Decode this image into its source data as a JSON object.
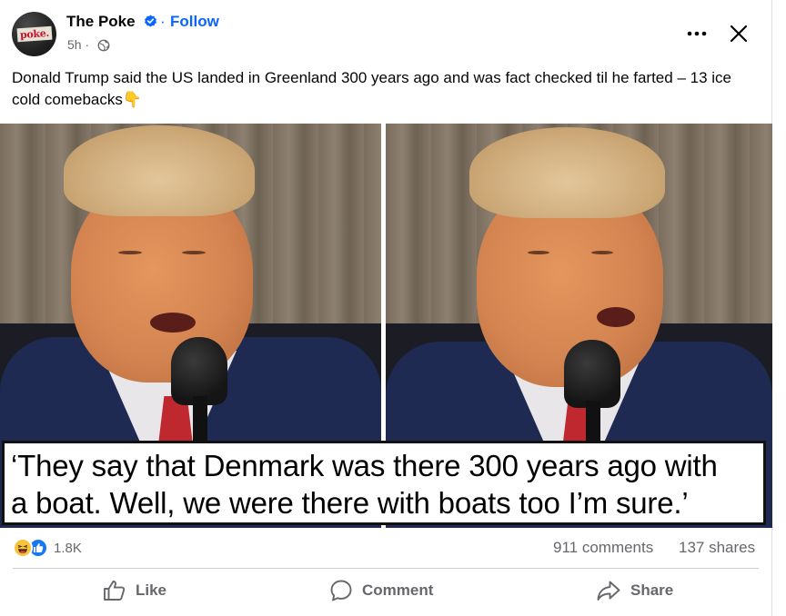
{
  "post": {
    "page_name": "The Poke",
    "avatar_text": "poke.",
    "follow_label": "Follow",
    "separator": "·",
    "time": "5h ·",
    "caption": "Donald Trump said the US landed in Greenland 300 years ago and was fact checked til he farted – 13 ice cold comebacks👇",
    "image_quote_line1": "‘They say that Denmark was there 300 years ago with",
    "image_quote_line2": "a boat. Well, we were there with boats too I’m sure.’"
  },
  "stats": {
    "reaction_count": "1.8K",
    "comments": "911 comments",
    "shares": "137 shares"
  },
  "actions": {
    "like": "Like",
    "comment": "Comment",
    "share": "Share"
  },
  "icons": {
    "verified": "verified-badge-icon",
    "globe": "globe-icon",
    "more": "more-options-icon",
    "close": "close-icon",
    "haha": "haha-reaction-icon",
    "like_reaction": "like-reaction-icon",
    "like": "thumbs-up-icon",
    "comment": "comment-bubble-icon",
    "share": "share-arrow-icon"
  },
  "colors": {
    "accent": "#0866ff",
    "secondary_text": "#65676b",
    "primary_text": "#050505"
  }
}
